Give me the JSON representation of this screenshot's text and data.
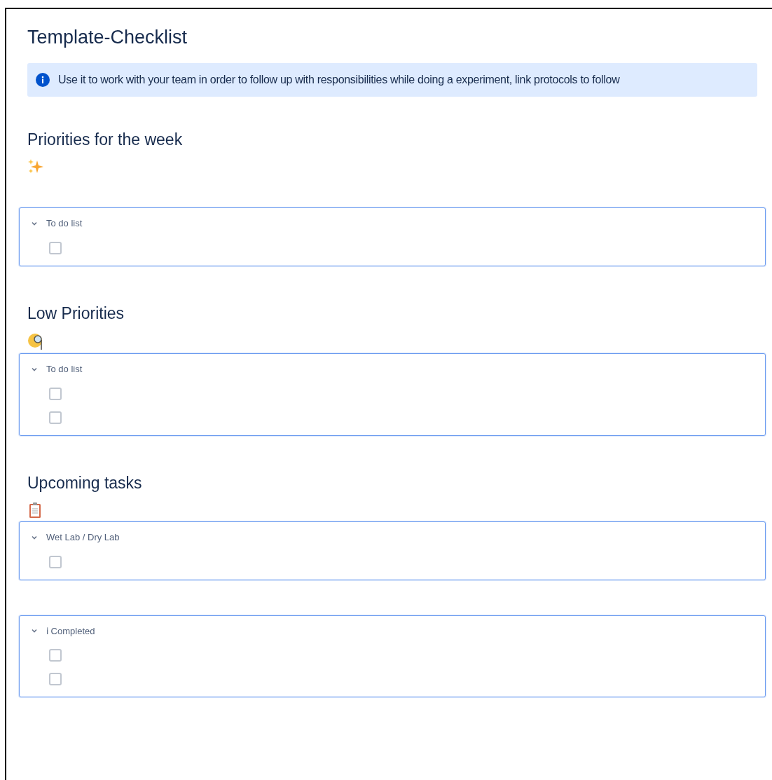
{
  "page": {
    "title": "Template-Checklist"
  },
  "info_panel": {
    "text": "Use it to work with your team in order to follow up with responsibilities while doing a experiment, link protocols to follow"
  },
  "sections": [
    {
      "heading": "Priorities for the week",
      "emoji": {
        "kind": "sparkles"
      },
      "panel": {
        "title": "To do list",
        "expanded": true,
        "items": [
          {
            "checked": false
          }
        ]
      }
    },
    {
      "heading": "Low Priorities",
      "emoji": {
        "kind": "monocle"
      },
      "panel": {
        "title": "To do list",
        "expanded": true,
        "items": [
          {
            "checked": false
          },
          {
            "checked": false
          }
        ]
      }
    },
    {
      "heading": "Upcoming tasks",
      "emoji": {
        "kind": "clipboard"
      },
      "panel": {
        "title": "Wet Lab / Dry Lab",
        "expanded": true,
        "items": [
          {
            "checked": false
          }
        ]
      }
    },
    {
      "panel": {
        "title": "ℹ Completed",
        "expanded": true,
        "items": [
          {
            "checked": false
          },
          {
            "checked": false
          }
        ]
      }
    }
  ]
}
